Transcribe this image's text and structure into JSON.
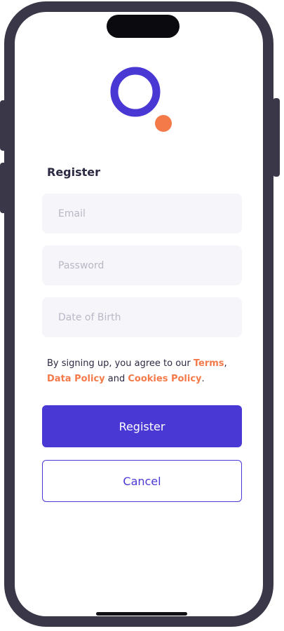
{
  "form": {
    "title": "Register",
    "email_placeholder": "Email",
    "password_placeholder": "Password",
    "dob_placeholder": "Date of Birth"
  },
  "terms": {
    "prefix": "By signing up, you agree to our ",
    "terms_link": "Terms",
    "comma": ",",
    "data_policy_link": "Data Policy",
    "and": " and ",
    "cookies_link": "Cookies Policy",
    "period": "."
  },
  "buttons": {
    "register_label": "Register",
    "cancel_label": "Cancel"
  },
  "colors": {
    "primary": "#4a38d4",
    "accent": "#f47a4a",
    "field_background": "#f6f6fa",
    "text": "#2b2a42",
    "frame": "#3a3848"
  },
  "icons": {
    "logo": "brand-logo"
  }
}
